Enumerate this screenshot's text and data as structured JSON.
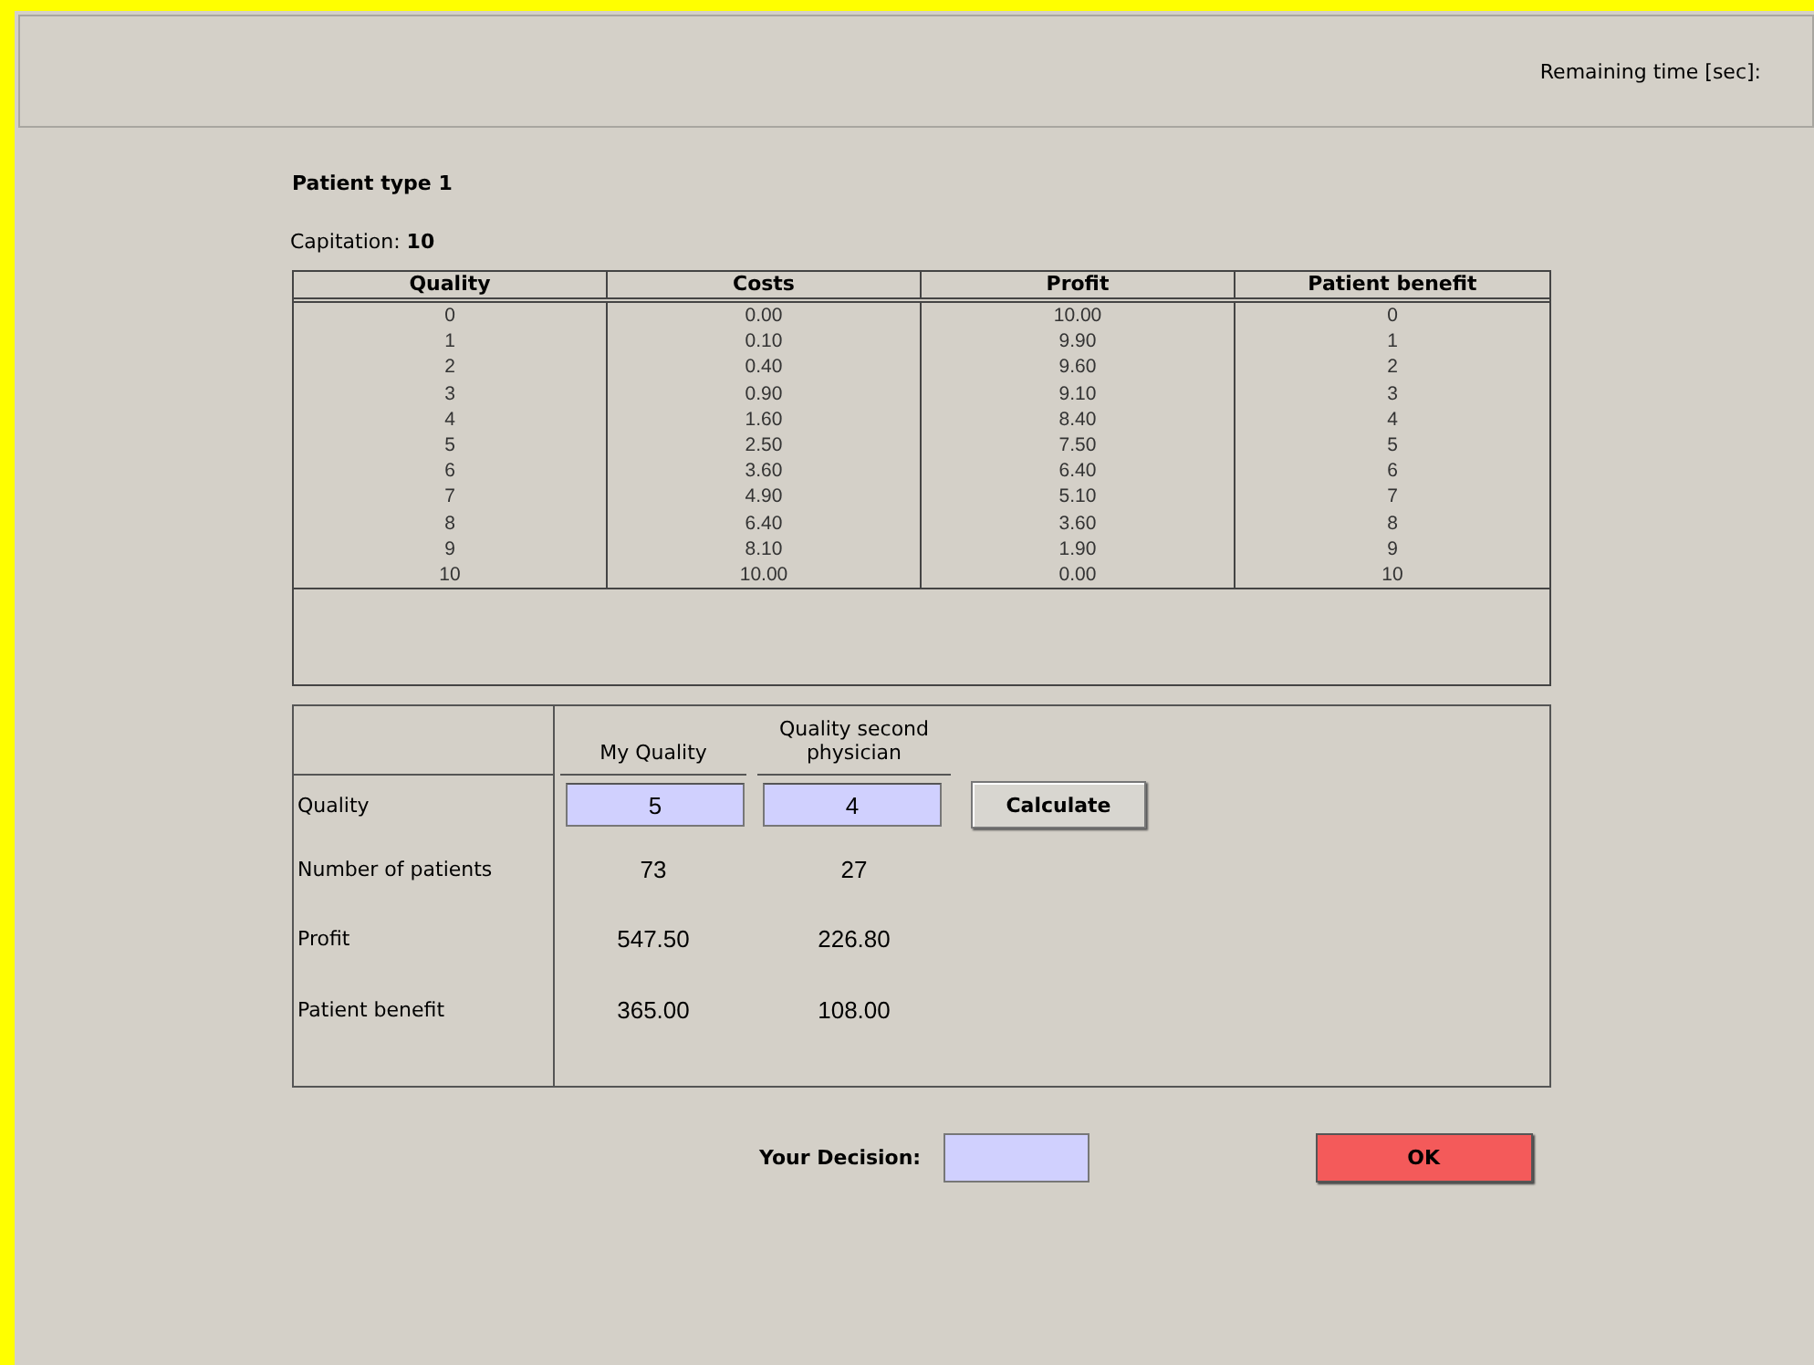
{
  "header": {
    "remaining_time_label": "Remaining time [sec]:"
  },
  "title": "Patient type 1",
  "capitation": {
    "label": "Capitation:",
    "value": "10"
  },
  "table": {
    "columns": [
      "Quality",
      "Costs",
      "Profit",
      "Patient benefit"
    ],
    "rows": [
      [
        "0",
        "0.00",
        "10.00",
        "0"
      ],
      [
        "1",
        "0.10",
        "9.90",
        "1"
      ],
      [
        "2",
        "0.40",
        "9.60",
        "2"
      ],
      [
        "3",
        "0.90",
        "9.10",
        "3"
      ],
      [
        "4",
        "1.60",
        "8.40",
        "4"
      ],
      [
        "5",
        "2.50",
        "7.50",
        "5"
      ],
      [
        "6",
        "3.60",
        "6.40",
        "6"
      ],
      [
        "7",
        "4.90",
        "5.10",
        "7"
      ],
      [
        "8",
        "6.40",
        "3.60",
        "8"
      ],
      [
        "9",
        "8.10",
        "1.90",
        "9"
      ],
      [
        "10",
        "10.00",
        "0.00",
        "10"
      ]
    ]
  },
  "calculator": {
    "columns": [
      "My Quality",
      "Quality second physician"
    ],
    "quality_label": "Quality",
    "quality_values": [
      "5",
      "4"
    ],
    "calculate_button": "Calculate",
    "results": [
      {
        "label": "Number of patients",
        "values": [
          "73",
          "27"
        ]
      },
      {
        "label": "Profit",
        "values": [
          "547.50",
          "226.80"
        ]
      },
      {
        "label": "Patient benefit",
        "values": [
          "365.00",
          "108.00"
        ]
      }
    ]
  },
  "decision": {
    "label": "Your Decision:"
  },
  "ok_button": "OK"
}
